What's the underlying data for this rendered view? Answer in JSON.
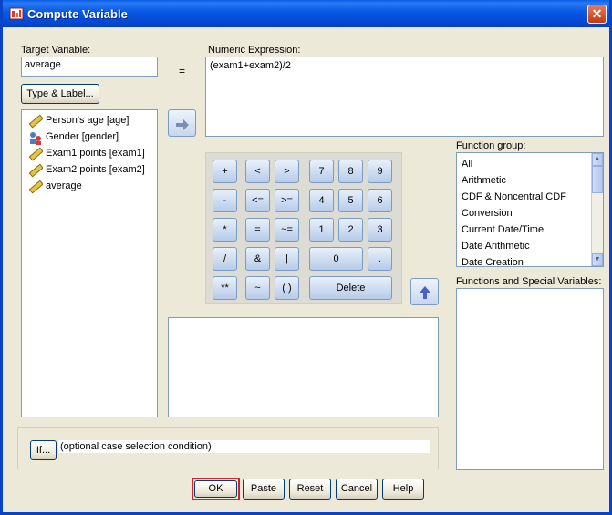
{
  "window": {
    "title": "Compute Variable",
    "close_glyph": "✕"
  },
  "target": {
    "label": "Target Variable:",
    "value": "average",
    "type_label_button": "Type & Label..."
  },
  "equals_sign": "=",
  "numeric_expression": {
    "label": "Numeric Expression:",
    "value": "(exam1+exam2)/2"
  },
  "variables": [
    {
      "label": "Person's age [age]",
      "icon": "scale-ruler-icon"
    },
    {
      "label": "Gender [gender]",
      "icon": "nominal-people-icon"
    },
    {
      "label": "Exam1 points [exam1]",
      "icon": "scale-ruler-icon"
    },
    {
      "label": "Exam2 points [exam2]",
      "icon": "scale-ruler-icon"
    },
    {
      "label": "average",
      "icon": "scale-ruler-icon"
    }
  ],
  "calculator": {
    "plus": "+",
    "lt": "<",
    "gt": ">",
    "k7": "7",
    "k8": "8",
    "k9": "9",
    "minus": "-",
    "le": "<=",
    "ge": ">=",
    "k4": "4",
    "k5": "5",
    "k6": "6",
    "mult": "*",
    "eq": "=",
    "ne": "~=",
    "k1": "1",
    "k2": "2",
    "k3": "3",
    "div": "/",
    "and": "&",
    "or": "|",
    "k0": "0",
    "dot": ".",
    "pow": "**",
    "not": "~",
    "parens": "( )",
    "delete": "Delete"
  },
  "function_group": {
    "label": "Function group:",
    "items": [
      "All",
      "Arithmetic",
      "CDF & Noncentral CDF",
      "Conversion",
      "Current Date/Time",
      "Date Arithmetic",
      "Date Creation"
    ]
  },
  "functions_special": {
    "label": "Functions and Special Variables:"
  },
  "if_section": {
    "button": "If...",
    "condition": "(optional case selection condition)"
  },
  "buttons": {
    "ok": "OK",
    "paste": "Paste",
    "reset": "Reset",
    "cancel": "Cancel",
    "help": "Help"
  },
  "colors": {
    "ok_highlight": "#d2232a",
    "titlebar": "#0a5fe6"
  }
}
